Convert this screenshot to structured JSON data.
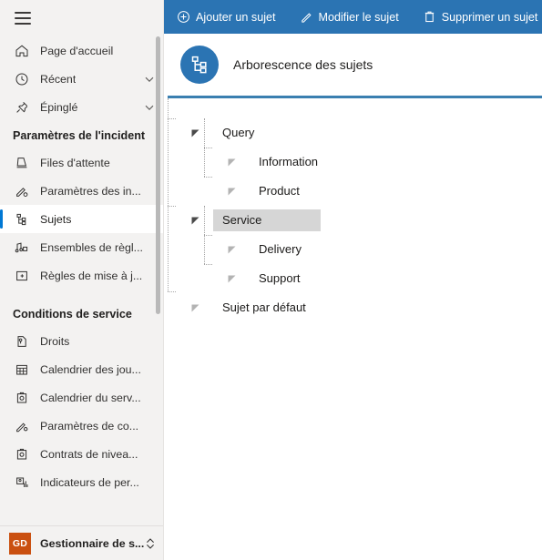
{
  "sidebar": {
    "menu_button": "menu-hamburger",
    "top_items": [
      {
        "label": "Page d'accueil",
        "icon": "home-icon",
        "chevron": false
      },
      {
        "label": "Récent",
        "icon": "clock-icon",
        "chevron": true
      },
      {
        "label": "Épinglé",
        "icon": "pin-icon",
        "chevron": true
      }
    ],
    "sections": [
      {
        "title": "Paramètres de l'incident",
        "items": [
          {
            "label": "Files d'attente",
            "icon": "queue-icon",
            "selected": false
          },
          {
            "label": "Paramètres des in...",
            "icon": "settings-incident-icon",
            "selected": false
          },
          {
            "label": "Sujets",
            "icon": "subject-tree-icon",
            "selected": true
          },
          {
            "label": "Ensembles de règl...",
            "icon": "rulesets-icon",
            "selected": false
          },
          {
            "label": "Règles de mise à j...",
            "icon": "update-rules-icon",
            "selected": false
          }
        ]
      },
      {
        "title": "Conditions de service",
        "items": [
          {
            "label": "Droits",
            "icon": "entitlement-icon",
            "selected": false
          },
          {
            "label": "Calendrier des jou...",
            "icon": "calendar-icon",
            "selected": false
          },
          {
            "label": "Calendrier du serv...",
            "icon": "service-calendar-icon",
            "selected": false
          },
          {
            "label": "Paramètres de co...",
            "icon": "settings-contract-icon",
            "selected": false
          },
          {
            "label": "Contrats de nivea...",
            "icon": "sla-icon",
            "selected": false
          },
          {
            "label": "Indicateurs de per...",
            "icon": "kpi-icon",
            "selected": false
          }
        ]
      }
    ],
    "account": {
      "initials": "GD",
      "label": "Gestionnaire de s...",
      "chevron_icon": "chevron-up-down-icon",
      "avatar_color": "#ca5010"
    }
  },
  "toolbar": {
    "background": "#2b74b3",
    "buttons": [
      {
        "label": "Ajouter un sujet",
        "icon": "add-circle-icon"
      },
      {
        "label": "Modifier le sujet",
        "icon": "pencil-icon"
      },
      {
        "label": "Supprimer un sujet",
        "icon": "trash-icon"
      }
    ]
  },
  "header": {
    "title": "Arborescence des sujets",
    "icon": "hierarchy-tree-icon",
    "icon_color": "#2b74b3",
    "rule_color": "#3a7fb0"
  },
  "tree": {
    "nodes": [
      {
        "label": "Query",
        "depth": 0,
        "selected": false,
        "caret": "triangle-expanded-icon"
      },
      {
        "label": "Information",
        "depth": 1,
        "selected": false,
        "caret": "triangle-collapsed-icon"
      },
      {
        "label": "Product",
        "depth": 1,
        "selected": false,
        "caret": "triangle-collapsed-icon"
      },
      {
        "label": "Service",
        "depth": 0,
        "selected": true,
        "caret": "triangle-expanded-icon"
      },
      {
        "label": "Delivery",
        "depth": 1,
        "selected": false,
        "caret": "triangle-collapsed-icon"
      },
      {
        "label": "Support",
        "depth": 1,
        "selected": false,
        "caret": "triangle-collapsed-icon"
      },
      {
        "label": "Sujet par défaut",
        "depth": 0,
        "selected": false,
        "caret": "triangle-collapsed-icon"
      }
    ]
  }
}
